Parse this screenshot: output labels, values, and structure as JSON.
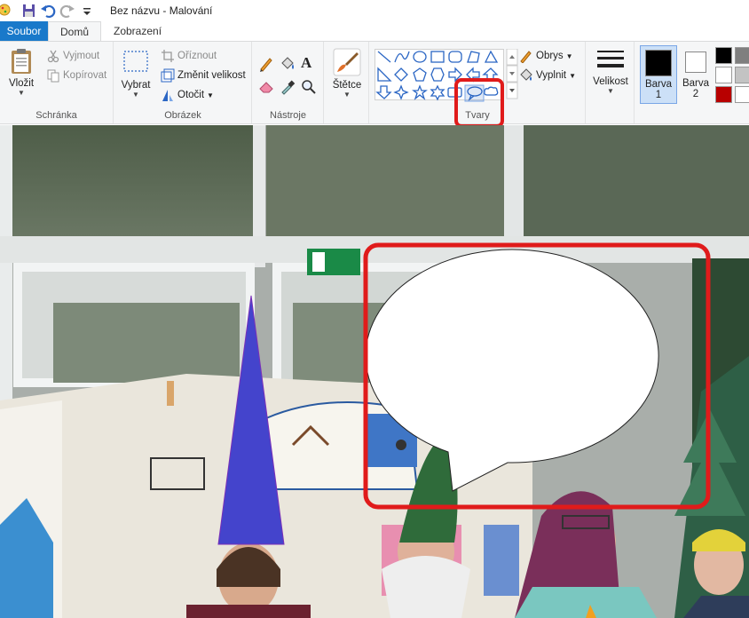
{
  "window": {
    "title": "Bez názvu - Malování"
  },
  "tabs": [
    {
      "label": "Soubor"
    },
    {
      "label": "Domů"
    },
    {
      "label": "Zobrazení"
    }
  ],
  "clipboard": {
    "group_label": "Schránka",
    "paste_label": "Vložit",
    "cut_label": "Vyjmout",
    "copy_label": "Kopírovat"
  },
  "image": {
    "group_label": "Obrázek",
    "select_label": "Vybrat",
    "crop_label": "Oříznout",
    "resize_label": "Změnit velikost",
    "rotate_label": "Otočit"
  },
  "tools": {
    "group_label": "Nástroje"
  },
  "brushes": {
    "label": "Štětce"
  },
  "shapes": {
    "group_label": "Tvary",
    "outline_label": "Obrys",
    "fill_label": "Vyplnit"
  },
  "size": {
    "label": "Velikost"
  },
  "colors": {
    "color1_label": "Barva",
    "color1_num": "1",
    "color2_label": "Barva",
    "color2_num": "2",
    "palette": [
      "#000000",
      "#7f7f7f",
      "#ffffff",
      "#c3c3c3",
      "#b80000",
      "#ffffff"
    ]
  },
  "accent": {
    "file_tab": "#1979ca",
    "highlight": "#e01b1b",
    "triangle": "#4444cc"
  }
}
